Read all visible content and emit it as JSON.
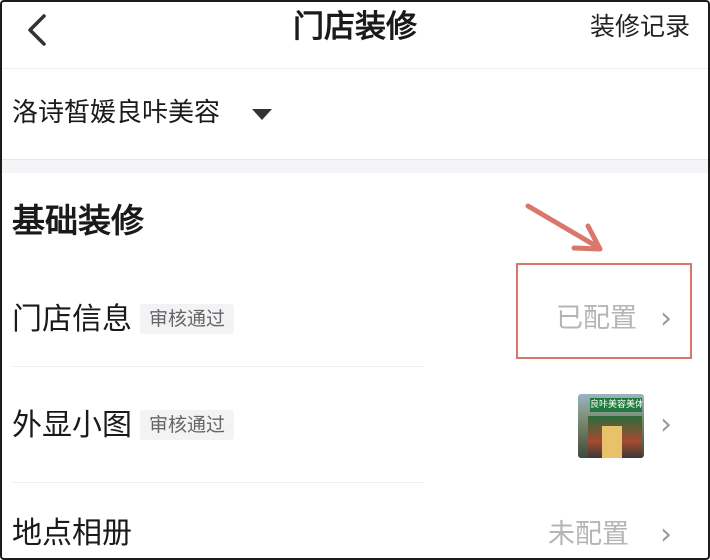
{
  "header": {
    "title": "门店装修",
    "record_label": "装修记录"
  },
  "store": {
    "name": "洛诗皙媛良咔美容"
  },
  "section": {
    "title": "基础装修"
  },
  "rows": [
    {
      "label": "门店信息",
      "badge": "审核通过",
      "status": "已配置"
    },
    {
      "label": "外显小图",
      "badge": "审核通过",
      "thumbnail_text": "良咔美容美体"
    },
    {
      "label": "地点相册",
      "status": "未配置"
    }
  ],
  "chevron": "›",
  "colors": {
    "annotation": "#d9776c",
    "status_text": "#b5b5b5",
    "badge_bg": "#f3f3f5"
  }
}
